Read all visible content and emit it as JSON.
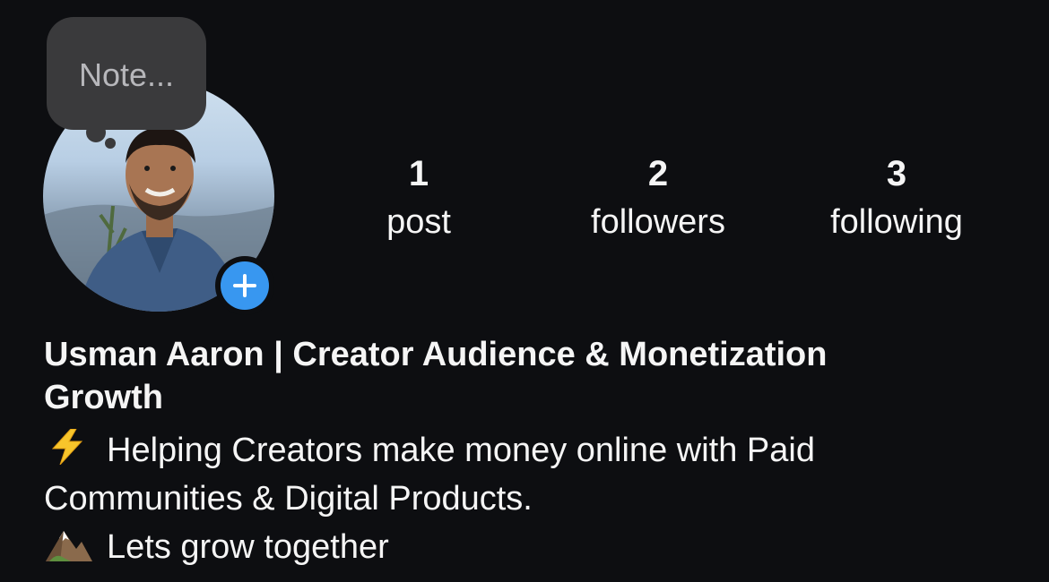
{
  "note": {
    "placeholder": "Note..."
  },
  "stats": [
    {
      "value": "1",
      "label": "post"
    },
    {
      "value": "2",
      "label": "followers"
    },
    {
      "value": "3",
      "label": "following"
    }
  ],
  "profile": {
    "name_line1": "Usman Aaron | Creator Audience & Monetization",
    "name_line2": "Growth"
  },
  "bio": {
    "line1_emoji": "lightning-icon",
    "line1": "Helping Creators make money online with Paid",
    "line2": "Communities & Digital Products.",
    "line3_emoji": "mountain-icon",
    "line3": "Lets grow together"
  },
  "colors": {
    "background": "#0d0e11",
    "accent": "#3897f0",
    "bubble": "#3a3a3c"
  }
}
